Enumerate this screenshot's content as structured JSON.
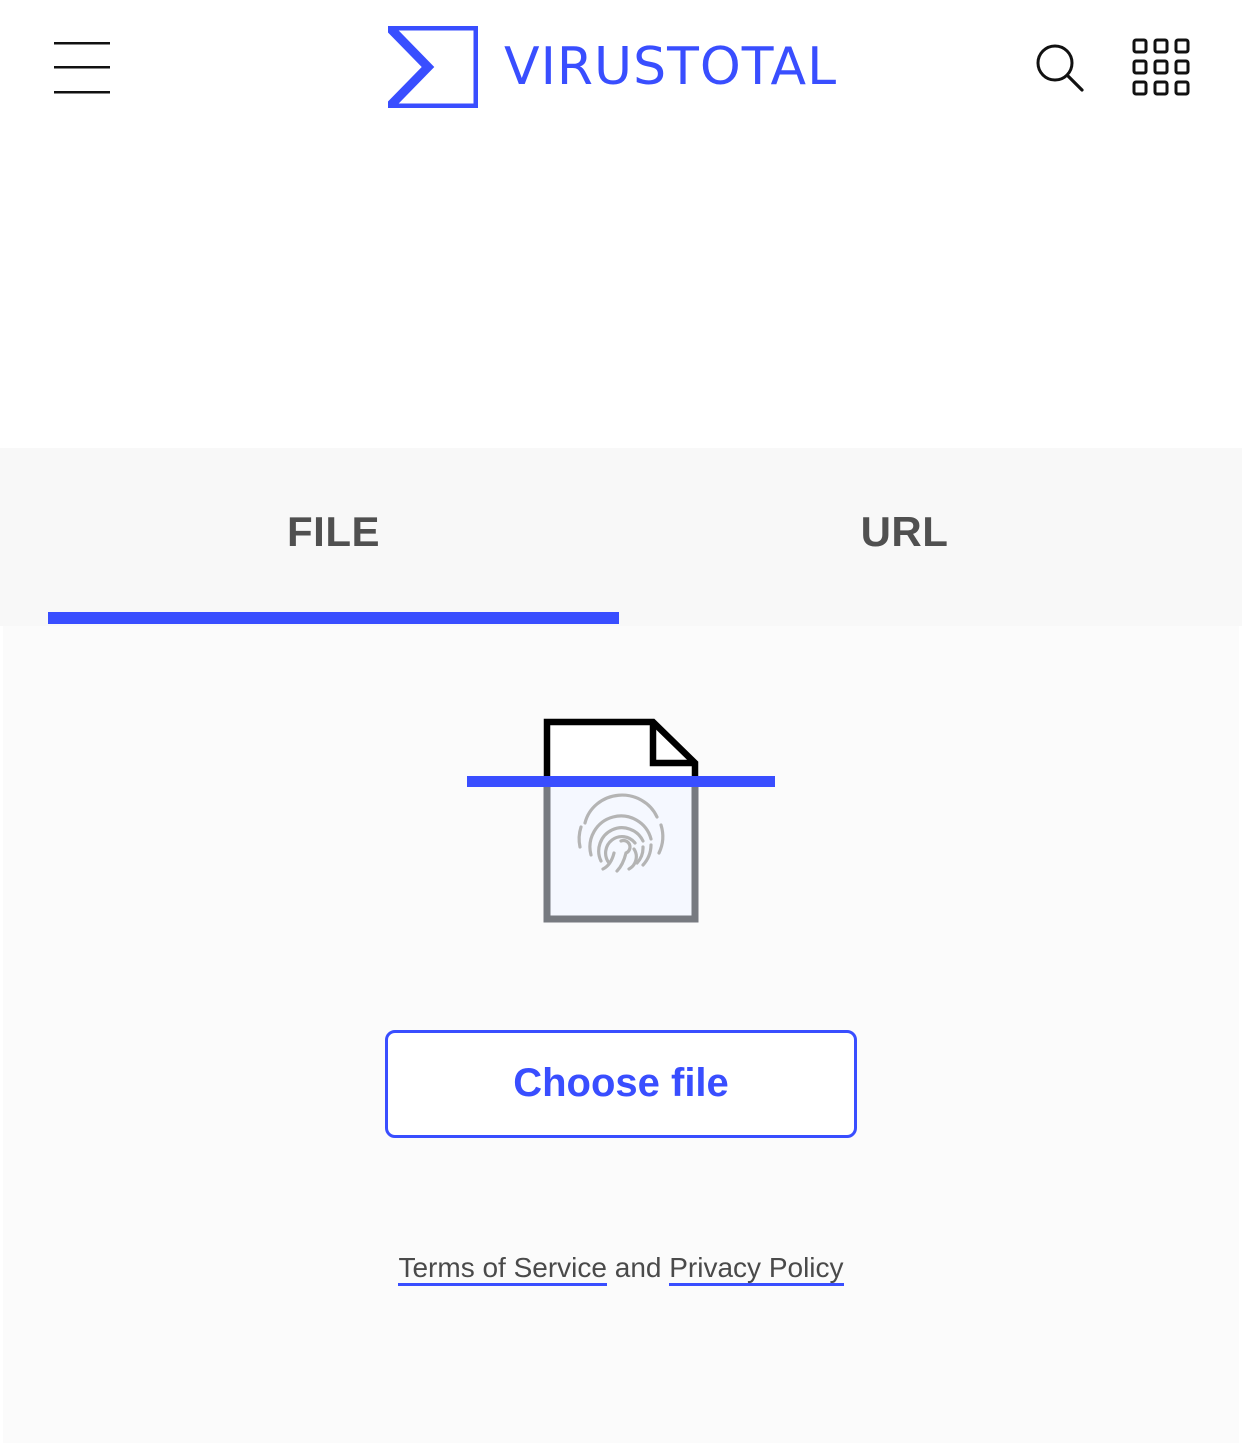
{
  "brand": {
    "name": "VIRUSTOTAL",
    "accent_color": "#394eff"
  },
  "header": {
    "menu_icon": "hamburger-menu-icon",
    "search_icon": "search-icon",
    "apps_icon": "apps-grid-icon"
  },
  "tabs": [
    {
      "label": "FILE",
      "selected": true
    },
    {
      "label": "URL",
      "selected": false
    }
  ],
  "upload": {
    "illustration": "file-fingerprint-scan-icon",
    "choose_file_label": "Choose file"
  },
  "legal": {
    "terms_label": "Terms of Service",
    "and_label": "and",
    "privacy_label": "Privacy Policy"
  }
}
